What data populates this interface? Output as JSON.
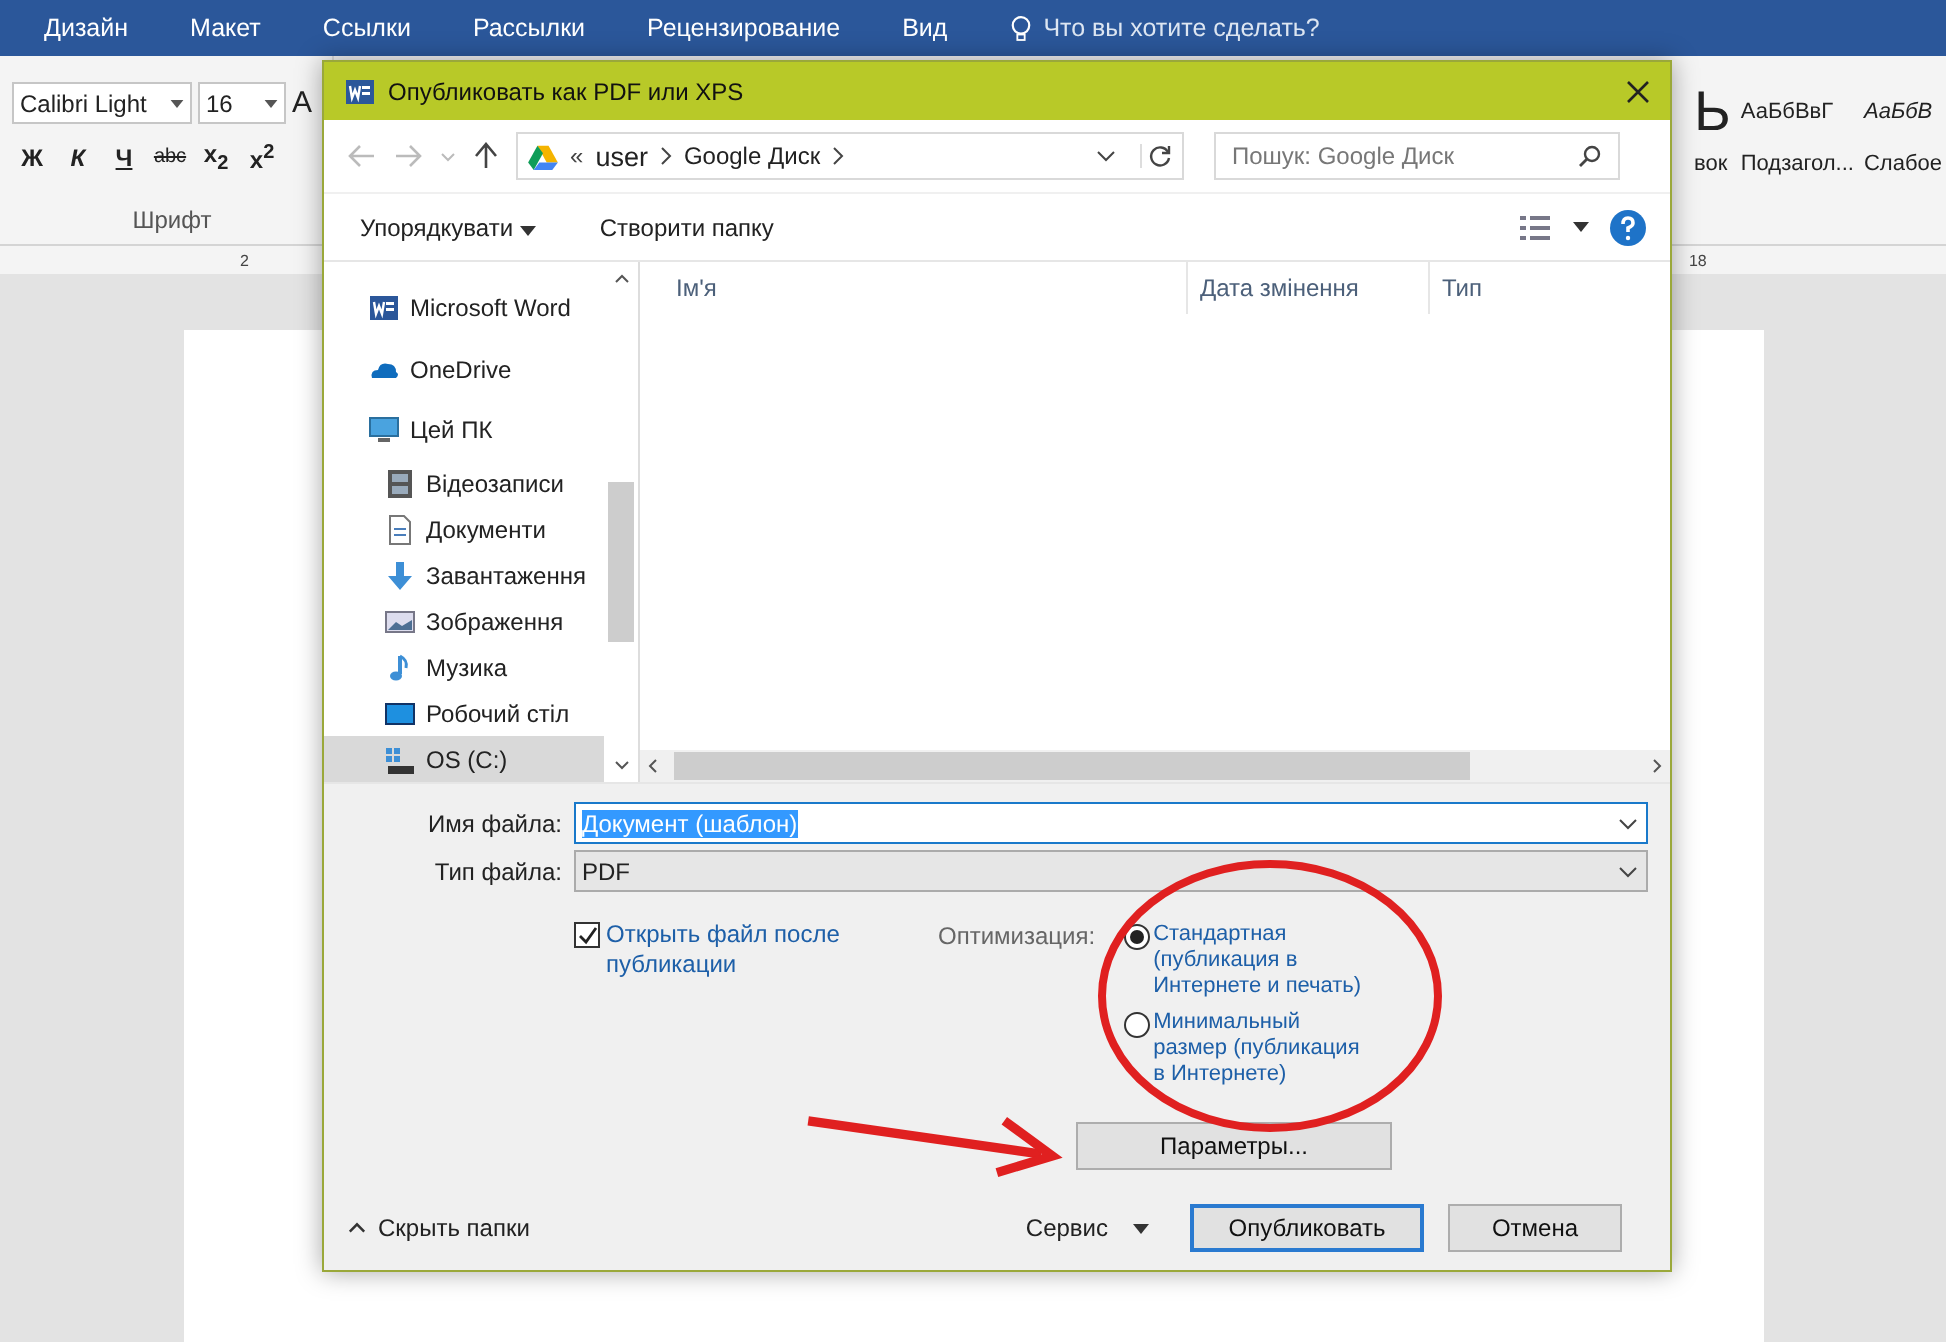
{
  "word": {
    "ribbon_tabs": [
      "Дизайн",
      "Макет",
      "Ссылки",
      "Рассылки",
      "Рецензирование",
      "Вид"
    ],
    "tell_me": "Что вы хотите сделать?",
    "font_name": "Calibri Light",
    "font_size": "16",
    "font_grow": "A",
    "format_buttons": [
      {
        "kind": "bold",
        "label": "Ж"
      },
      {
        "kind": "italic",
        "label": "К"
      },
      {
        "kind": "underline",
        "label": "Ч"
      },
      {
        "kind": "strike",
        "label": "abc"
      },
      {
        "kind": "sub",
        "label": "x$_{2}$"
      },
      {
        "kind": "sup",
        "label": "x$^{2}$"
      }
    ],
    "group_label": "Шрифт",
    "styles": [
      {
        "kind": "heading",
        "sample": "Ь",
        "name": "вок"
      },
      {
        "kind": "normal",
        "sample": "АаБбВвГ",
        "name": "Подзагол..."
      },
      {
        "kind": "italic",
        "sample": "АаБбВ",
        "name": "Слабое"
      }
    ],
    "ruler_labels": [
      "2",
      "18"
    ]
  },
  "dialog": {
    "title": "Опубликовать как PDF или XPS",
    "address": {
      "prefix": "«",
      "crumbs": [
        "user",
        "Google Диск"
      ]
    },
    "search": {
      "placeholder": "Пошук: Google Диск"
    },
    "organize": "Упорядкувати",
    "new_folder": "Створити папку",
    "nav_items": [
      {
        "kind": "word",
        "label": "Microsoft Word",
        "selected": false
      },
      {
        "kind": "cloud",
        "label": "OneDrive",
        "selected": false
      },
      {
        "kind": "pc",
        "label": "Цей ПК",
        "selected": false,
        "children": [
          {
            "kind": "video",
            "label": "Відеозаписи",
            "selected": false
          },
          {
            "kind": "doc",
            "label": "Документи",
            "selected": false
          },
          {
            "kind": "download",
            "label": "Завантаження",
            "selected": false
          },
          {
            "kind": "image",
            "label": "Зображення",
            "selected": false
          },
          {
            "kind": "music",
            "label": "Музика",
            "selected": false
          },
          {
            "kind": "desktop",
            "label": "Робочий стіл",
            "selected": false
          },
          {
            "kind": "drive",
            "label": "OS (C:)",
            "selected": true
          }
        ]
      }
    ],
    "columns": [
      "Ім'я",
      "Дата змінення",
      "Тип"
    ],
    "filename": {
      "label": "Имя файла:",
      "value": "Документ (шаблон)"
    },
    "filetype": {
      "label": "Тип файла:",
      "value": "PDF"
    },
    "open_after": {
      "label": "Открыть файл после публикации",
      "checked": true
    },
    "optimization": {
      "label": "Оптимизация:",
      "options": [
        {
          "label": "Стандартная (публикация в Интернете и печать)",
          "selected": true
        },
        {
          "label": "Минимальный размер (публикация в Интернете)",
          "selected": false
        }
      ]
    },
    "options_button": "Параметры...",
    "hide_folders": "Скрыть папки",
    "tools": "Сервис",
    "publish": "Опубликовать",
    "cancel": "Отмена"
  }
}
